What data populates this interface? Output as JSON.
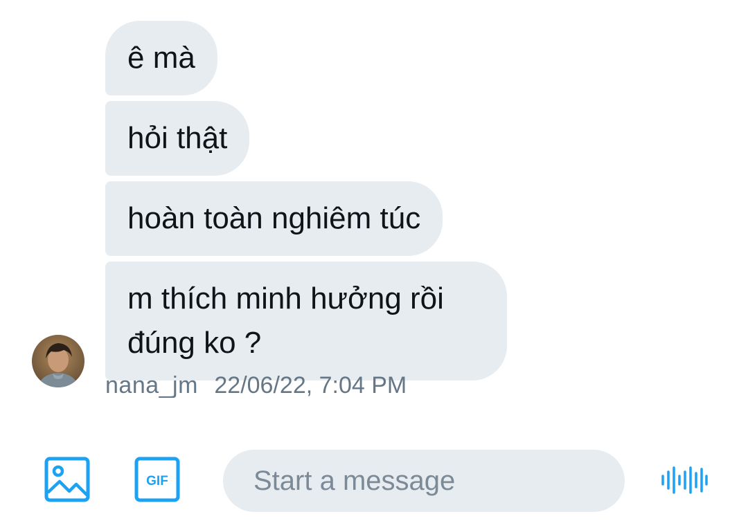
{
  "messages": [
    {
      "text": "ê mà"
    },
    {
      "text": "hỏi thật"
    },
    {
      "text": "hoàn toàn nghiêm túc"
    },
    {
      "text": "m thích minh hưởng rồi đúng ko ?"
    }
  ],
  "sender": {
    "username": "nana_jm",
    "timestamp": "22/06/22, 7:04 PM",
    "avatar_icon": "user-avatar"
  },
  "composer": {
    "placeholder": "Start a message",
    "image_icon": "image-icon",
    "gif_icon": "gif-icon",
    "gif_label": "GIF",
    "voice_icon": "voice-waveform-icon"
  },
  "colors": {
    "bubble": "#e6ecf0",
    "accent": "#1da1f2",
    "meta_text": "#657786"
  }
}
